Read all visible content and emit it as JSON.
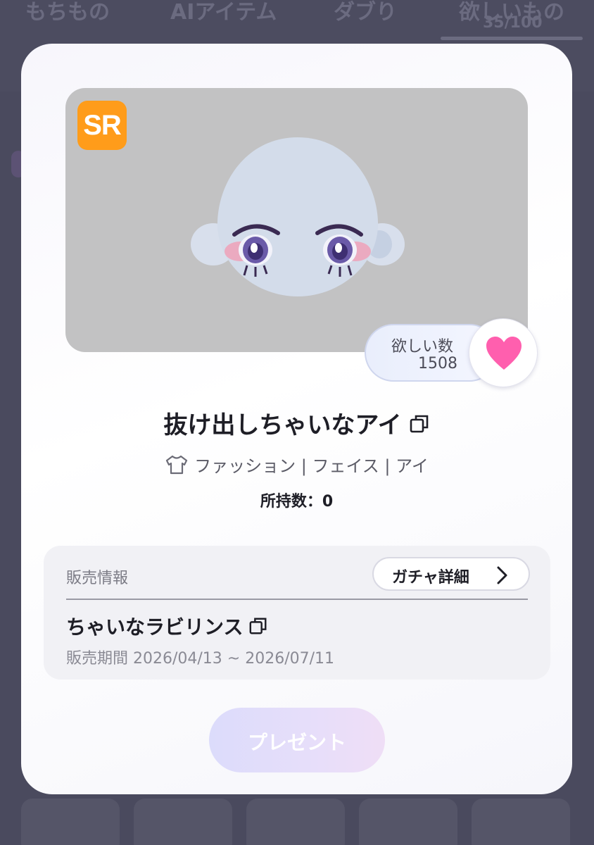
{
  "background_tabs": [
    {
      "label": "もちもの"
    },
    {
      "label": "AIアイテム"
    },
    {
      "label": "ダブり"
    },
    {
      "label": "欲しいもの",
      "count": "35/100"
    }
  ],
  "item": {
    "rarity": "SR",
    "name": "抜け出しちゃいなアイ",
    "category": "ファッション | フェイス | アイ",
    "owned": "所持数：0"
  },
  "wishlist": {
    "label": "欲しい数",
    "count": "1508"
  },
  "sale_info": {
    "label": "販売情報",
    "gacha_detail_button": "ガチャ詳細",
    "gacha_name": "ちゃいなラビリンス",
    "period": "販売期間 2026/04/13 ~ 2026/07/11"
  },
  "present_button": "プレゼント",
  "colors": {
    "rarity_badge": "#ff9c1a",
    "heart": "#ff5fae",
    "preview_bg": "#c2c2c3",
    "overlay_bg": "#4a4a5e"
  },
  "icons": {
    "rarity": "sr-badge",
    "wish": "heart-icon",
    "copy": "copy-icon",
    "category": "shirt-icon",
    "gacha": "chevron-right-icon"
  }
}
